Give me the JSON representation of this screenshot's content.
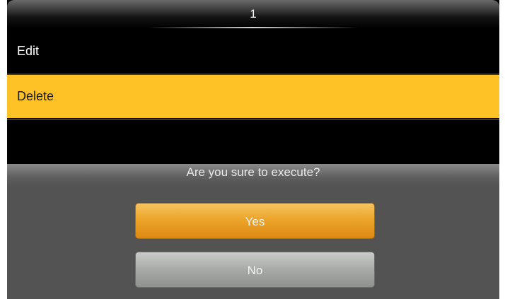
{
  "title_bar": {
    "title": "1"
  },
  "menu": {
    "items": [
      {
        "label": "Edit",
        "selected": false
      },
      {
        "label": "Delete",
        "selected": true
      }
    ]
  },
  "dialog": {
    "message": "Are you sure to execute?",
    "yes_label": "Yes",
    "no_label": "No"
  },
  "colors": {
    "highlight": "#fec126",
    "yes_button": "#eca52b",
    "no_button": "#a8aaa7",
    "dialog_bg": "#535353"
  }
}
